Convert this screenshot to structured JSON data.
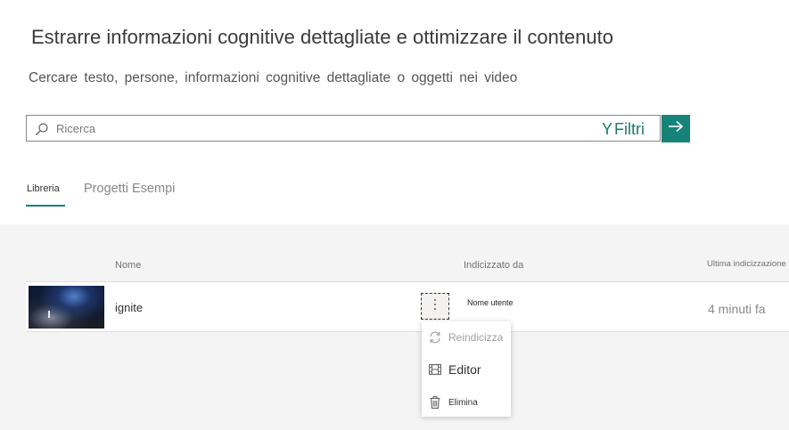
{
  "header": {
    "title": "Estrarre informazioni cognitive dettagliate e ottimizzare il contenuto",
    "subtitle": "Cercare testo, persone, informazioni cognitive dettagliate o oggetti nei video"
  },
  "search": {
    "placeholder": "Ricerca",
    "filters_label": "Filtri",
    "filters_icon": "Y"
  },
  "tabs": [
    {
      "label": "Libreria",
      "active": true
    },
    {
      "label": "Progetti Esempi",
      "active": false
    }
  ],
  "table": {
    "columns": [
      "Nome",
      "Indicizzato da",
      "Ultima indicizzazione"
    ],
    "rows": [
      {
        "name": "ignite",
        "indexed_by": "Nome utente",
        "last_indexed": "4 minuti fa"
      }
    ]
  },
  "context_menu": {
    "items": [
      {
        "label": "Reindicizza",
        "icon": "refresh-icon"
      },
      {
        "label": "Editor",
        "icon": "film-icon"
      },
      {
        "label": "Elimina",
        "icon": "trash-icon"
      }
    ]
  },
  "colors": {
    "accent": "#168378",
    "filters_text": "#1b7a6c"
  }
}
